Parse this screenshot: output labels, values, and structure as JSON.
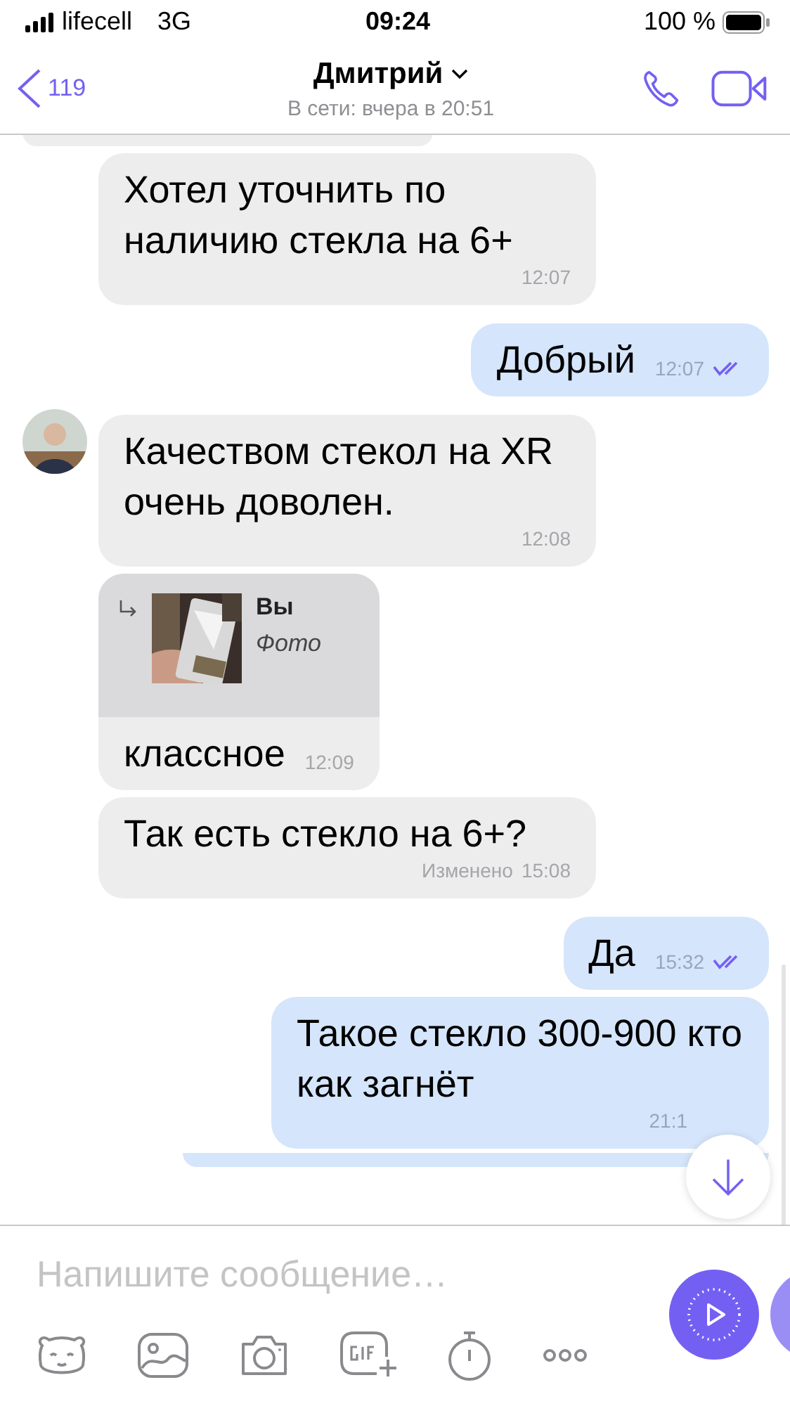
{
  "status_bar": {
    "carrier": "lifecell",
    "network": "3G",
    "time": "09:24",
    "battery": "100 %"
  },
  "header": {
    "back_count": "119",
    "title": "Дмитрий",
    "subtitle": "В сети: вчера в 20:51"
  },
  "messages": [
    {
      "kind": "partial",
      "outgoing": false
    },
    {
      "kind": "text",
      "outgoing": false,
      "avatar": false,
      "text": "Хотел уточнить по наличию стекла на 6+",
      "time": "12:07"
    },
    {
      "kind": "text",
      "outgoing": true,
      "text": "Добрый",
      "time": "12:07",
      "read": true
    },
    {
      "kind": "text",
      "outgoing": false,
      "avatar": true,
      "text": "Качеством стекол на XR очень доволен.",
      "time": "12:08"
    },
    {
      "kind": "reply",
      "outgoing": false,
      "avatar": false,
      "quote_author": "Вы",
      "quote_text": "Фото",
      "text": "классное",
      "time": "12:09"
    },
    {
      "kind": "text",
      "outgoing": false,
      "avatar": false,
      "text": "Так есть стекло на 6+?",
      "edited": "Изменено",
      "time": "15:08"
    },
    {
      "kind": "text",
      "outgoing": true,
      "text": "Да",
      "time": "15:32",
      "read": true
    },
    {
      "kind": "text",
      "outgoing": true,
      "text": "Такое стекло 300-900 кто как загнёт",
      "time": "21:1"
    },
    {
      "kind": "partial",
      "outgoing": true
    }
  ],
  "composer": {
    "placeholder": "Напишите сообщение…"
  }
}
